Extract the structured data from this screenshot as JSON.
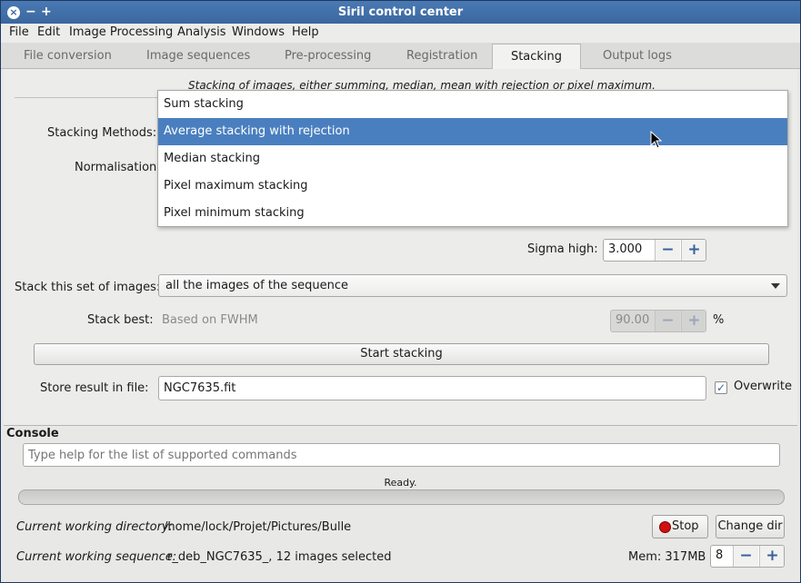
{
  "window": {
    "title": "Siril control center",
    "close_glyph": "×",
    "minimize_glyph": "−",
    "maximize_glyph": "+"
  },
  "menubar": [
    "File",
    "Edit",
    "Image Processing",
    "Analysis",
    "Windows",
    "Help"
  ],
  "tabs": [
    "File conversion",
    "Image sequences",
    "Pre-processing",
    "Registration",
    "Stacking",
    "Output logs"
  ],
  "active_tab": "Stacking",
  "stacking": {
    "description": "Stacking of images, either summing, median, mean with rejection or pixel maximum.",
    "methods_label": "Stacking Methods:",
    "normalisation_label": "Normalisation:",
    "method_options": [
      "Sum stacking",
      "Average stacking with rejection",
      "Median stacking",
      "Pixel maximum stacking",
      "Pixel minimum stacking"
    ],
    "selected_method": "Average stacking with rejection",
    "sigma_high_label": "Sigma high:",
    "sigma_high_value": "3.000",
    "stack_set_label": "Stack this set of images:",
    "stack_set_value": "all the images of the sequence",
    "stack_best_label": "Stack best:",
    "stack_best_value": "Based on FWHM",
    "stack_best_percent": "90.00",
    "percent_symbol": "%",
    "start_button": "Start stacking",
    "store_result_label": "Store result in file:",
    "store_result_value": "NGC7635.fit",
    "overwrite_label": "Overwrite",
    "overwrite_checked": true
  },
  "console": {
    "title": "Console",
    "input_placeholder": "Type help for the list of supported commands",
    "status": "Ready.",
    "progress_fraction": 0,
    "cwd_label": "Current working directory:",
    "cwd_value": "/home/lock/Projet/Pictures/Bulle",
    "seq_label": "Current working sequence:",
    "seq_value": "r_deb_NGC7635_, 12 images selected",
    "stop_button": "Stop",
    "change_dir_button": "Change dir",
    "mem_label": "Mem: 317MB",
    "threads_value": "8"
  },
  "colors": {
    "accent": "#4a7fbf",
    "titlebar": "#3a679f",
    "stop_red": "#d01010"
  }
}
